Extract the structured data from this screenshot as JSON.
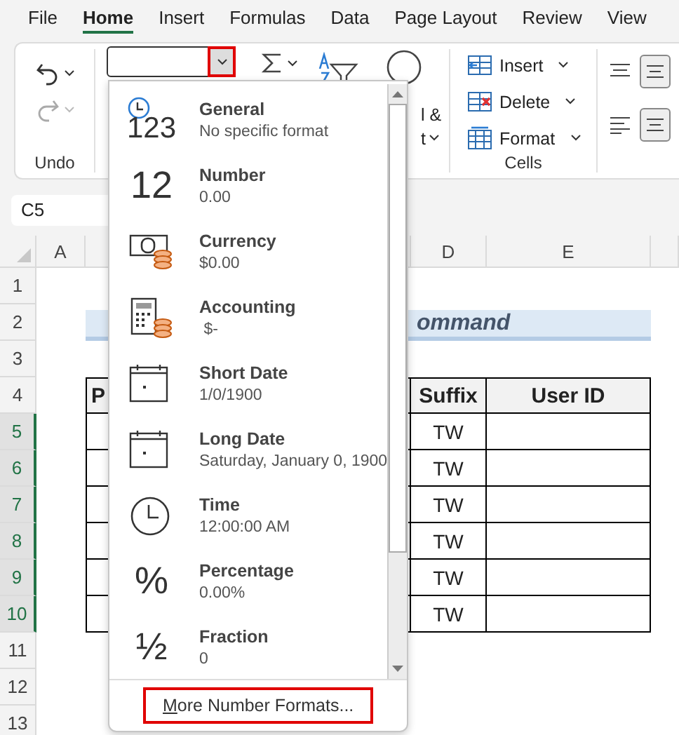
{
  "menu_tabs": [
    {
      "label": "File",
      "selected": false
    },
    {
      "label": "Home",
      "selected": true
    },
    {
      "label": "Insert",
      "selected": false
    },
    {
      "label": "Formulas",
      "selected": false
    },
    {
      "label": "Data",
      "selected": false
    },
    {
      "label": "Page Layout",
      "selected": false
    },
    {
      "label": "Review",
      "selected": false
    },
    {
      "label": "View",
      "selected": false
    }
  ],
  "ribbon": {
    "undo_group": {
      "label": "Undo"
    },
    "editing_labels": [
      "l &",
      "t"
    ],
    "cells_group": {
      "label": "Cells",
      "buttons": [
        {
          "kind": "insert",
          "label": "Insert"
        },
        {
          "kind": "delete",
          "label": "Delete"
        },
        {
          "kind": "format",
          "label": "Format"
        }
      ]
    }
  },
  "name_box": "C5",
  "column_headers": [
    "A",
    "D",
    "E"
  ],
  "row_headers": [
    {
      "label": "1",
      "selected": false
    },
    {
      "label": "2",
      "selected": false
    },
    {
      "label": "3",
      "selected": false
    },
    {
      "label": "4",
      "selected": false
    },
    {
      "label": "5",
      "selected": true
    },
    {
      "label": "6",
      "selected": true
    },
    {
      "label": "7",
      "selected": true
    },
    {
      "label": "8",
      "selected": true
    },
    {
      "label": "9",
      "selected": true
    },
    {
      "label": "10",
      "selected": true
    },
    {
      "label": "11",
      "selected": false
    },
    {
      "label": "12",
      "selected": false
    },
    {
      "label": "13",
      "selected": false
    }
  ],
  "sheet": {
    "title": "ommand",
    "table": {
      "header": [
        "P",
        "Suffix",
        "User ID"
      ],
      "rows": [
        {
          "suffix": "TW"
        },
        {
          "suffix": "TW"
        },
        {
          "suffix": "TW"
        },
        {
          "suffix": "TW"
        },
        {
          "suffix": "TW"
        },
        {
          "suffix": "TW"
        }
      ]
    }
  },
  "format_menu": {
    "items": [
      {
        "kind": "general",
        "glyph": "123",
        "name": "General",
        "example": "No specific format"
      },
      {
        "kind": "number",
        "glyph": "12",
        "name": "Number",
        "example": "0.00"
      },
      {
        "kind": "currency",
        "name": "Currency",
        "example": "$0.00"
      },
      {
        "kind": "accounting",
        "name": "Accounting",
        "example": " $-"
      },
      {
        "kind": "short_date",
        "name": "Short Date",
        "example": "1/0/1900"
      },
      {
        "kind": "long_date",
        "name": "Long Date",
        "example": "Saturday, January 0, 1900"
      },
      {
        "kind": "time",
        "name": "Time",
        "example": "12:00:00 AM"
      },
      {
        "kind": "percentage",
        "glyph": "%",
        "name": "Percentage",
        "example": "0.00%"
      },
      {
        "kind": "fraction",
        "glyph": "½",
        "name": "Fraction",
        "example": "0"
      }
    ],
    "footer": "More Number Formats..."
  }
}
